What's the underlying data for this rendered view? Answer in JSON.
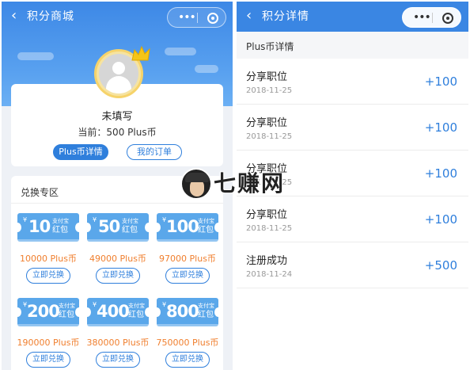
{
  "left": {
    "title": "积分商城",
    "back_icon": "chevron-left-icon",
    "menu_dots": "•••",
    "profile": {
      "nickname": "未填写",
      "balance": "当前：500 Plus币",
      "btn_details": "Plus币详情",
      "btn_orders": "我的订单"
    },
    "exchange": {
      "heading": "兑换专区",
      "items": [
        {
          "currency": "¥",
          "amount": "10",
          "sub": "支付宝",
          "kind": "红包",
          "price": "10000 Plus币",
          "button": "立即兑换"
        },
        {
          "currency": "¥",
          "amount": "50",
          "sub": "支付宝",
          "kind": "红包",
          "price": "49000 Plus币",
          "button": "立即兑换"
        },
        {
          "currency": "¥",
          "amount": "100",
          "sub": "支付宝",
          "kind": "红包",
          "price": "97000 Plus币",
          "button": "立即兑换"
        },
        {
          "currency": "¥",
          "amount": "200",
          "sub": "支付宝",
          "kind": "红包",
          "price": "190000 Plus币",
          "button": "立即兑换"
        },
        {
          "currency": "¥",
          "amount": "400",
          "sub": "支付宝",
          "kind": "红包",
          "price": "380000 Plus币",
          "button": "立即兑换"
        },
        {
          "currency": "¥",
          "amount": "800",
          "sub": "支付宝",
          "kind": "红包",
          "price": "750000 Plus币",
          "button": "立即兑换"
        }
      ]
    }
  },
  "right": {
    "title": "积分详情",
    "menu_dots": "•••",
    "section": "Plus币详情",
    "records": [
      {
        "title": "分享职位",
        "date": "2018-11-25",
        "value": "+100"
      },
      {
        "title": "分享职位",
        "date": "2018-11-25",
        "value": "+100"
      },
      {
        "title": "分享职位",
        "date": "2018-11-25",
        "value": "+100"
      },
      {
        "title": "分享职位",
        "date": "2018-11-25",
        "value": "+100"
      },
      {
        "title": "注册成功",
        "date": "2018-11-24",
        "value": "+500"
      }
    ]
  },
  "watermark": {
    "text": "七赚网"
  },
  "colors": {
    "primary": "#2f7fdc",
    "banner": "#3d88e6",
    "coupon": "#5aa7ea",
    "price": "#f07f2e"
  }
}
